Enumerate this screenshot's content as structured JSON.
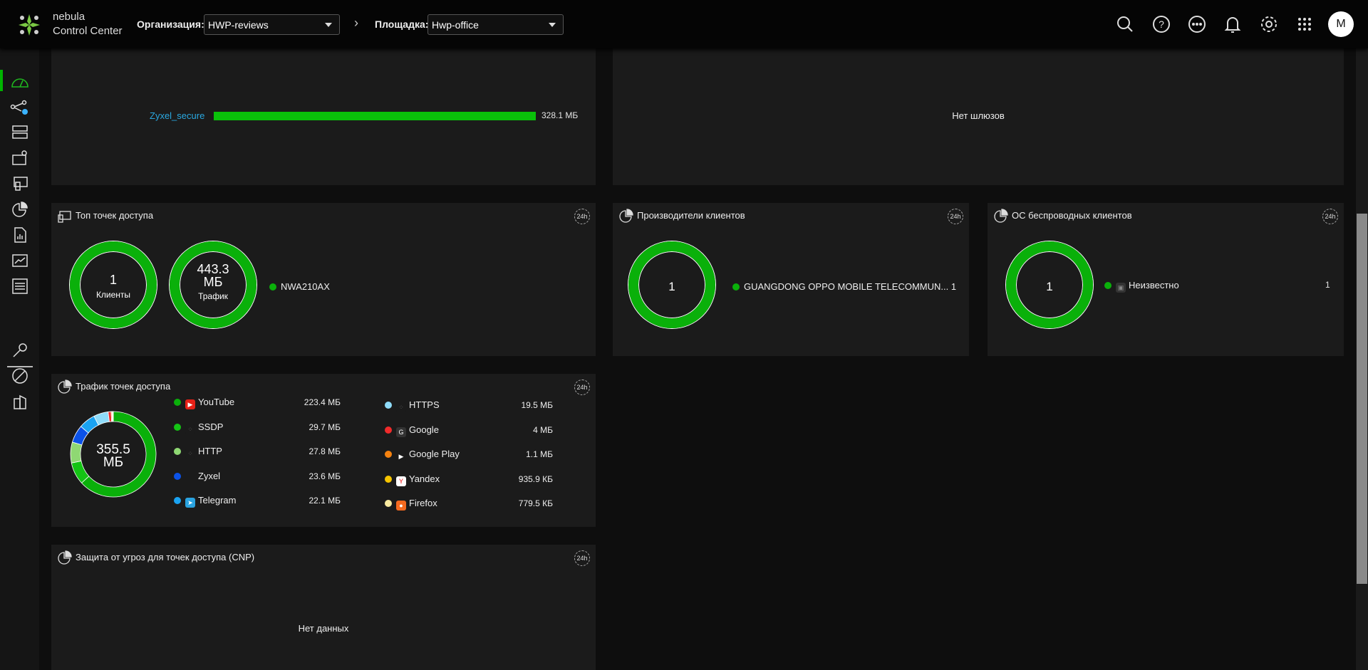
{
  "header": {
    "brand_line1": "nebula",
    "brand_line2": "Control Center",
    "org_label": "Организация:",
    "org_value": "HWP-reviews",
    "site_label": "Площадка:",
    "site_value": "Hwp-office",
    "avatar": "M",
    "icons": [
      "search-icon",
      "help-icon",
      "more-icon",
      "bell-icon",
      "gear-icon",
      "apps-grid-icon"
    ]
  },
  "sidebar": {
    "items": [
      "dashboard-icon",
      "topology-icon",
      "devices-icon",
      "site-map-icon",
      "clients-icon",
      "analytics-icon",
      "reports-icon",
      "monitor-icon",
      "configure-icon",
      "license-icon",
      "support-icon",
      "organization-icon"
    ],
    "active": "dashboard-icon"
  },
  "ssid_card": {
    "ssid": "Zyxel_secure",
    "usage": "328.1 МБ",
    "fill_pct": 100
  },
  "gateway_card": {
    "empty": "Нет шлюзов"
  },
  "top_ap": {
    "title": "Топ точек доступа",
    "badge": "24h",
    "clients_value": "1",
    "clients_label": "Клиенты",
    "traffic_value": "443.3 МБ",
    "traffic_label": "Трафик",
    "ap": "NWA210AX"
  },
  "manufacturers": {
    "title": "Производители клиентов",
    "badge": "24h",
    "total": "1",
    "items": [
      {
        "name": "GUANGDONG OPPO MOBILE TELECOMMUN...",
        "count": "1",
        "color": "#0ab00a"
      }
    ]
  },
  "os": {
    "title": "ОС беспроводных клиентов",
    "badge": "24h",
    "total": "1",
    "items": [
      {
        "name": "Неизвестно",
        "count": "1",
        "color": "#0ab00a"
      }
    ]
  },
  "ap_traffic": {
    "title": "Трафик точек доступа",
    "badge": "24h",
    "total": "355.5",
    "unit": "МБ",
    "apps": [
      {
        "name": "YouTube",
        "value": "223.4 МБ",
        "mb": 223.4,
        "color": "#0ab00a",
        "icon": "youtube-icon"
      },
      {
        "name": "SSDP",
        "value": "29.7 МБ",
        "mb": 29.7,
        "color": "#14c414",
        "icon": "generic-app-icon"
      },
      {
        "name": "HTTP",
        "value": "27.8 МБ",
        "mb": 27.8,
        "color": "#8fd873",
        "icon": "generic-app-icon"
      },
      {
        "name": "Zyxel",
        "value": "23.6 МБ",
        "mb": 23.6,
        "color": "#0b52e8",
        "icon": ""
      },
      {
        "name": "Telegram",
        "value": "22.1 МБ",
        "mb": 22.1,
        "color": "#1aa3f2",
        "icon": "telegram-icon"
      },
      {
        "name": "HTTPS",
        "value": "19.5 МБ",
        "mb": 19.5,
        "color": "#8fdcfa",
        "icon": "generic-app-icon"
      },
      {
        "name": "Google",
        "value": "4 МБ",
        "mb": 4,
        "color": "#f02b2b",
        "icon": "google-icon"
      },
      {
        "name": "Google Play",
        "value": "1.1 МБ",
        "mb": 1.1,
        "color": "#f5820f",
        "icon": "google-play-icon"
      },
      {
        "name": "Yandex",
        "value": "935.9 КБ",
        "mb": 0.9359,
        "color": "#f7c500",
        "icon": "yandex-icon"
      },
      {
        "name": "Firefox",
        "value": "779.5 КБ",
        "mb": 0.7795,
        "color": "#f9eaa0",
        "icon": "firefox-icon"
      }
    ]
  },
  "cnp": {
    "title": "Защита от угроз для точек доступа (CNP)",
    "badge": "24h",
    "empty": "Нет данных"
  }
}
